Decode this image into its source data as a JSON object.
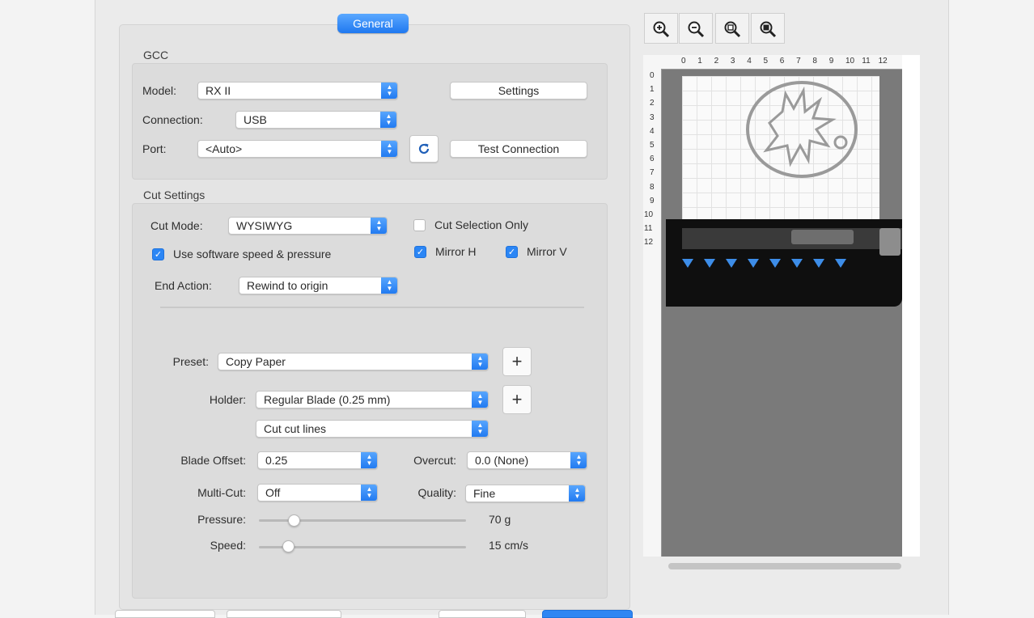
{
  "tabs": {
    "general_label": "General"
  },
  "gcc": {
    "title": "GCC",
    "model_label": "Model:",
    "model_value": "RX II",
    "connection_label": "Connection:",
    "connection_value": "USB",
    "port_label": "Port:",
    "port_value": "<Auto>",
    "settings_button": "Settings",
    "test_connection_button": "Test Connection",
    "refresh_icon": "refresh-icon"
  },
  "cut_settings": {
    "title": "Cut Settings",
    "cut_mode_label": "Cut Mode:",
    "cut_mode_value": "WYSIWYG",
    "cut_selection_only_label": "Cut Selection Only",
    "cut_selection_only_checked": false,
    "use_software_speed_label": "Use software speed & pressure",
    "use_software_speed_checked": true,
    "mirror_h_label": "Mirror H",
    "mirror_h_checked": true,
    "mirror_v_label": "Mirror V",
    "mirror_v_checked": true,
    "end_action_label": "End Action:",
    "end_action_value": "Rewind to origin",
    "preset_label": "Preset:",
    "preset_value": "Copy Paper",
    "holder_label": "Holder:",
    "holder_value": "Regular Blade (0.25 mm)",
    "cut_lines_value": "Cut cut lines",
    "blade_offset_label": "Blade Offset:",
    "blade_offset_value": "0.25",
    "overcut_label": "Overcut:",
    "overcut_value": "0.0 (None)",
    "multicut_label": "Multi-Cut:",
    "multicut_value": "Off",
    "quality_label": "Quality:",
    "quality_value": "Fine",
    "pressure_label": "Pressure:",
    "pressure_value": "70 g",
    "pressure_level": 0.15,
    "speed_label": "Speed:",
    "speed_value": "15 cm/s",
    "speed_level": 0.12,
    "add_button": "+"
  },
  "preview": {
    "zoom_icons": [
      "zoom-in-icon",
      "zoom-out-icon",
      "zoom-fit-icon",
      "zoom-actual-icon"
    ],
    "ruler_top": [
      "0",
      "1",
      "2",
      "3",
      "4",
      "5",
      "6",
      "7",
      "8",
      "9",
      "10",
      "11",
      "12"
    ],
    "ruler_left": [
      "0",
      "1",
      "2",
      "3",
      "4",
      "5",
      "6",
      "7",
      "8",
      "9",
      "10",
      "11",
      "12"
    ],
    "colors": {
      "accent": "#1f78f0",
      "mat_gray": "#7a7a7a",
      "machine_black": "#111111",
      "marker_blue": "#3d8de8"
    }
  }
}
